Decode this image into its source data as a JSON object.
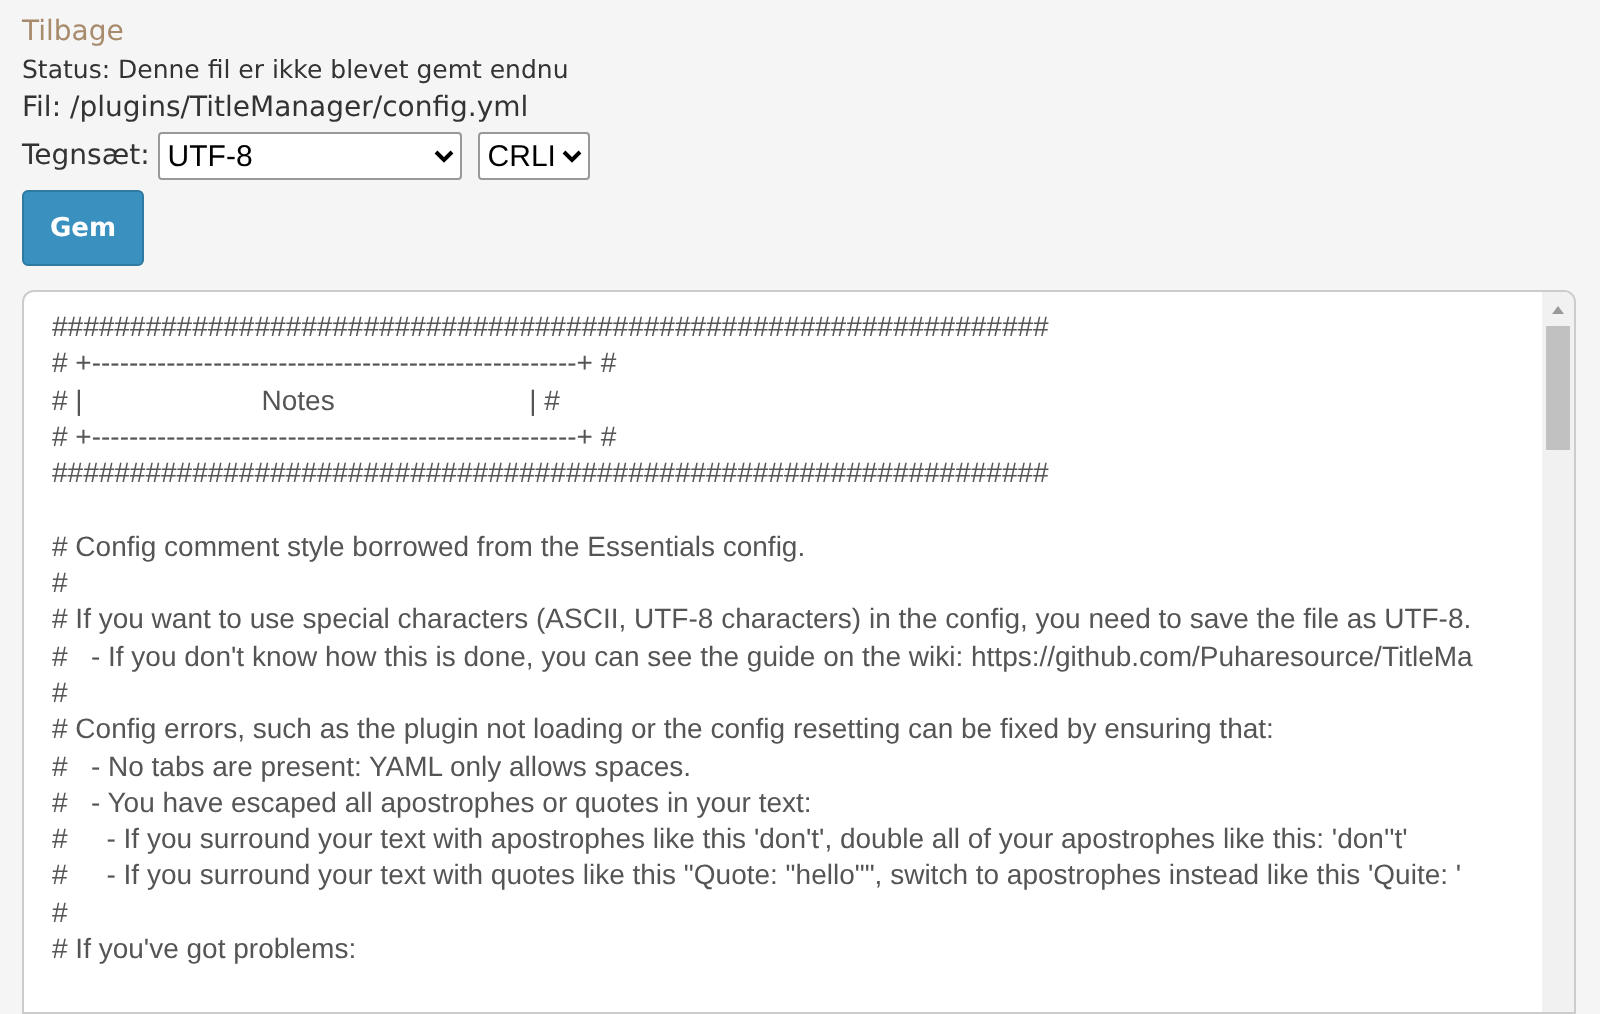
{
  "back_link": "Tilbage",
  "status": "Status: Denne fil er ikke blevet gemt endnu",
  "file": "Fil: /plugins/TitleManager/config.yml",
  "charset": {
    "label": "Tegnsæt:",
    "encoding": "UTF-8",
    "line_ending": "CRLI"
  },
  "save_button": "Gem",
  "editor_blocks": [
    [
      "################################################################",
      "# +----------------------------------------------------+ #",
      "# |                       Notes                         | #",
      "# +----------------------------------------------------+ #",
      "################################################################"
    ],
    [
      "# Config comment style borrowed from the Essentials config.",
      "#",
      "# If you want to use special characters (ASCII, UTF-8 characters) in the config, you need to save the file as UTF-8.",
      "#   - If you don't know how this is done, you can see the guide on the wiki: https://github.com/Puharesource/TitleMa",
      "#",
      "# Config errors, such as the plugin not loading or the config resetting can be fixed by ensuring that:",
      "#   - No tabs are present: YAML only allows spaces.",
      "#   - You have escaped all apostrophes or quotes in your text:",
      "#     - If you surround your text with apostrophes like this 'don't', double all of your apostrophes like this: 'don''t'",
      "#     - If you surround your text with quotes like this \"Quote: \"hello\"\", switch to apostrophes instead like this 'Quite: '",
      "#",
      "# If you've got problems:"
    ]
  ]
}
